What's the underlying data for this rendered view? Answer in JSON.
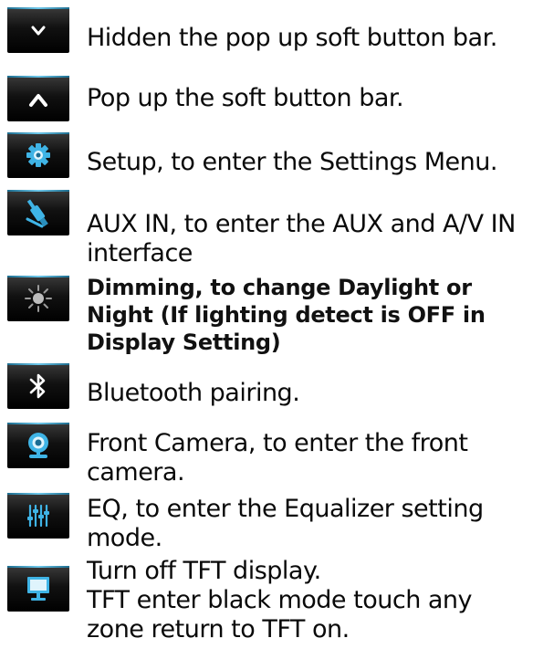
{
  "items": [
    {
      "icon": "chevron-down-icon",
      "lines": [
        "Hidden the pop up soft button bar."
      ]
    },
    {
      "icon": "chevron-up-icon",
      "lines": [
        "Pop up the soft button bar."
      ]
    },
    {
      "icon": "gear-icon",
      "lines": [
        "Setup, to enter the Settings Menu."
      ]
    },
    {
      "icon": "aux-plug-icon",
      "lines": [
        "AUX IN, to enter the AUX and A/V IN",
        " interface"
      ]
    },
    {
      "icon": "sun-icon",
      "lines": [
        "Dimming, to change Daylight or",
        "Night (If lighting detect is OFF in",
        "Display Setting)"
      ]
    },
    {
      "icon": "bluetooth-icon",
      "lines": [
        "Bluetooth pairing."
      ]
    },
    {
      "icon": "webcam-icon",
      "lines": [
        "Front Camera, to enter the  front",
        "camera."
      ]
    },
    {
      "icon": "equalizer-icon",
      "lines": [
        "EQ, to enter the Equalizer setting",
        "mode."
      ]
    },
    {
      "icon": "monitor-icon",
      "lines": [
        "Turn off TFT display.",
        "TFT enter black mode touch any",
        "zone return to TFT on."
      ]
    }
  ],
  "colors": {
    "icon_blue": "#3fb4e6",
    "button_top_line": "#6cc7ea",
    "text": "#0a0a0a"
  }
}
